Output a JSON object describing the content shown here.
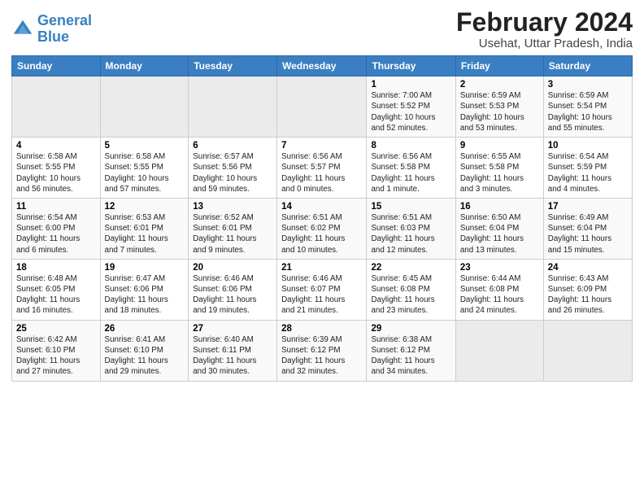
{
  "logo": {
    "line1": "General",
    "line2": "Blue"
  },
  "title": "February 2024",
  "subtitle": "Usehat, Uttar Pradesh, India",
  "days_header": [
    "Sunday",
    "Monday",
    "Tuesday",
    "Wednesday",
    "Thursday",
    "Friday",
    "Saturday"
  ],
  "weeks": [
    [
      {
        "num": "",
        "detail": ""
      },
      {
        "num": "",
        "detail": ""
      },
      {
        "num": "",
        "detail": ""
      },
      {
        "num": "",
        "detail": ""
      },
      {
        "num": "1",
        "detail": "Sunrise: 7:00 AM\nSunset: 5:52 PM\nDaylight: 10 hours\nand 52 minutes."
      },
      {
        "num": "2",
        "detail": "Sunrise: 6:59 AM\nSunset: 5:53 PM\nDaylight: 10 hours\nand 53 minutes."
      },
      {
        "num": "3",
        "detail": "Sunrise: 6:59 AM\nSunset: 5:54 PM\nDaylight: 10 hours\nand 55 minutes."
      }
    ],
    [
      {
        "num": "4",
        "detail": "Sunrise: 6:58 AM\nSunset: 5:55 PM\nDaylight: 10 hours\nand 56 minutes."
      },
      {
        "num": "5",
        "detail": "Sunrise: 6:58 AM\nSunset: 5:55 PM\nDaylight: 10 hours\nand 57 minutes."
      },
      {
        "num": "6",
        "detail": "Sunrise: 6:57 AM\nSunset: 5:56 PM\nDaylight: 10 hours\nand 59 minutes."
      },
      {
        "num": "7",
        "detail": "Sunrise: 6:56 AM\nSunset: 5:57 PM\nDaylight: 11 hours\nand 0 minutes."
      },
      {
        "num": "8",
        "detail": "Sunrise: 6:56 AM\nSunset: 5:58 PM\nDaylight: 11 hours\nand 1 minute."
      },
      {
        "num": "9",
        "detail": "Sunrise: 6:55 AM\nSunset: 5:58 PM\nDaylight: 11 hours\nand 3 minutes."
      },
      {
        "num": "10",
        "detail": "Sunrise: 6:54 AM\nSunset: 5:59 PM\nDaylight: 11 hours\nand 4 minutes."
      }
    ],
    [
      {
        "num": "11",
        "detail": "Sunrise: 6:54 AM\nSunset: 6:00 PM\nDaylight: 11 hours\nand 6 minutes."
      },
      {
        "num": "12",
        "detail": "Sunrise: 6:53 AM\nSunset: 6:01 PM\nDaylight: 11 hours\nand 7 minutes."
      },
      {
        "num": "13",
        "detail": "Sunrise: 6:52 AM\nSunset: 6:01 PM\nDaylight: 11 hours\nand 9 minutes."
      },
      {
        "num": "14",
        "detail": "Sunrise: 6:51 AM\nSunset: 6:02 PM\nDaylight: 11 hours\nand 10 minutes."
      },
      {
        "num": "15",
        "detail": "Sunrise: 6:51 AM\nSunset: 6:03 PM\nDaylight: 11 hours\nand 12 minutes."
      },
      {
        "num": "16",
        "detail": "Sunrise: 6:50 AM\nSunset: 6:04 PM\nDaylight: 11 hours\nand 13 minutes."
      },
      {
        "num": "17",
        "detail": "Sunrise: 6:49 AM\nSunset: 6:04 PM\nDaylight: 11 hours\nand 15 minutes."
      }
    ],
    [
      {
        "num": "18",
        "detail": "Sunrise: 6:48 AM\nSunset: 6:05 PM\nDaylight: 11 hours\nand 16 minutes."
      },
      {
        "num": "19",
        "detail": "Sunrise: 6:47 AM\nSunset: 6:06 PM\nDaylight: 11 hours\nand 18 minutes."
      },
      {
        "num": "20",
        "detail": "Sunrise: 6:46 AM\nSunset: 6:06 PM\nDaylight: 11 hours\nand 19 minutes."
      },
      {
        "num": "21",
        "detail": "Sunrise: 6:46 AM\nSunset: 6:07 PM\nDaylight: 11 hours\nand 21 minutes."
      },
      {
        "num": "22",
        "detail": "Sunrise: 6:45 AM\nSunset: 6:08 PM\nDaylight: 11 hours\nand 23 minutes."
      },
      {
        "num": "23",
        "detail": "Sunrise: 6:44 AM\nSunset: 6:08 PM\nDaylight: 11 hours\nand 24 minutes."
      },
      {
        "num": "24",
        "detail": "Sunrise: 6:43 AM\nSunset: 6:09 PM\nDaylight: 11 hours\nand 26 minutes."
      }
    ],
    [
      {
        "num": "25",
        "detail": "Sunrise: 6:42 AM\nSunset: 6:10 PM\nDaylight: 11 hours\nand 27 minutes."
      },
      {
        "num": "26",
        "detail": "Sunrise: 6:41 AM\nSunset: 6:10 PM\nDaylight: 11 hours\nand 29 minutes."
      },
      {
        "num": "27",
        "detail": "Sunrise: 6:40 AM\nSunset: 6:11 PM\nDaylight: 11 hours\nand 30 minutes."
      },
      {
        "num": "28",
        "detail": "Sunrise: 6:39 AM\nSunset: 6:12 PM\nDaylight: 11 hours\nand 32 minutes."
      },
      {
        "num": "29",
        "detail": "Sunrise: 6:38 AM\nSunset: 6:12 PM\nDaylight: 11 hours\nand 34 minutes."
      },
      {
        "num": "",
        "detail": ""
      },
      {
        "num": "",
        "detail": ""
      }
    ]
  ]
}
